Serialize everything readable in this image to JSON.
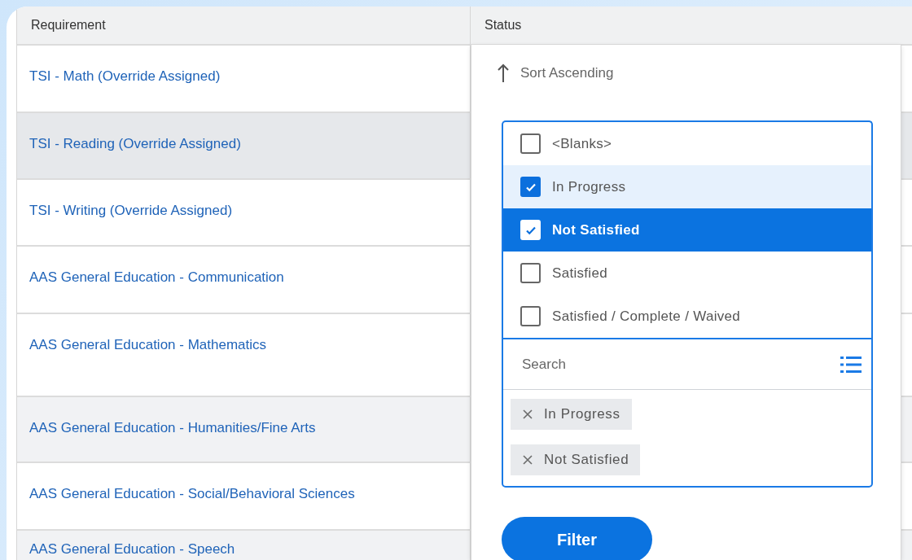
{
  "table": {
    "columns": [
      "Requirement",
      "Status"
    ],
    "rows": [
      {
        "requirement": "TSI - Math (Override Assigned)",
        "highlighted": false,
        "striped": false
      },
      {
        "requirement": "TSI - Reading (Override Assigned)",
        "highlighted": true,
        "striped": false
      },
      {
        "requirement": "TSI - Writing (Override Assigned)",
        "highlighted": false,
        "striped": false
      },
      {
        "requirement": "AAS General Education - Communication",
        "highlighted": false,
        "striped": false
      },
      {
        "requirement": "AAS General Education - Mathematics",
        "highlighted": false,
        "striped": false
      },
      {
        "requirement": "AAS General Education - Humanities/Fine Arts",
        "highlighted": false,
        "striped": true
      },
      {
        "requirement": "AAS General Education - Social/Behavioral Sciences",
        "highlighted": false,
        "striped": false
      },
      {
        "requirement": "AAS General Education - Speech",
        "highlighted": false,
        "striped": true
      }
    ]
  },
  "sort_menu": {
    "items": [
      {
        "label": "Sort Ascending"
      }
    ]
  },
  "filter": {
    "options": [
      {
        "label": "<Blanks>",
        "checked": false,
        "selected": false,
        "hovered": false
      },
      {
        "label": "In Progress",
        "checked": true,
        "selected": false,
        "hovered": true
      },
      {
        "label": "Not Satisfied",
        "checked": true,
        "selected": true,
        "hovered": false
      },
      {
        "label": "Satisfied",
        "checked": false,
        "selected": false,
        "hovered": false
      },
      {
        "label": "Satisfied / Complete / Waived",
        "checked": false,
        "selected": false,
        "hovered": false
      }
    ],
    "search": {
      "placeholder": "Search"
    },
    "chips": [
      "In Progress",
      "Not Satisfied"
    ],
    "button": "Filter"
  }
}
